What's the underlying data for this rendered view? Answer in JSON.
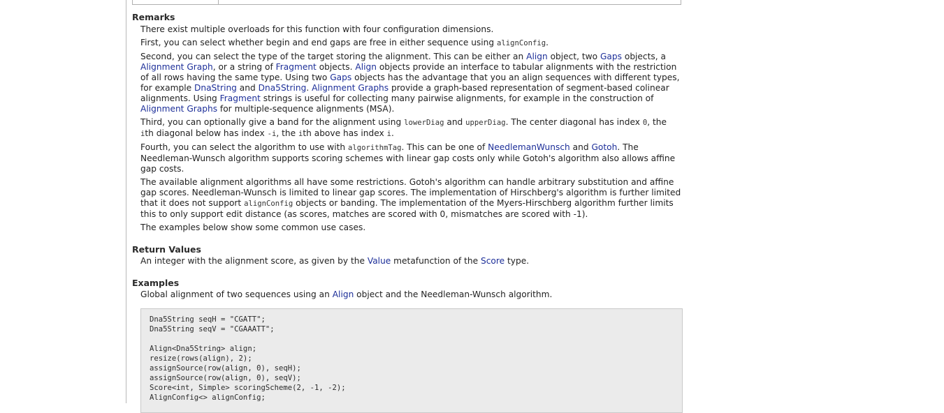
{
  "remarks": {
    "heading": "Remarks",
    "p1": "There exist multiple overloads for this function with four configuration dimensions.",
    "p2": {
      "t1": "First, you can select whether begin and end gaps are free in either sequence using ",
      "c1": "alignConfig",
      "t2": "."
    },
    "p3": {
      "t1": "Second, you can select the type of the target storing the alignment. This can be either an ",
      "l1": "Align",
      "t2": " object, two ",
      "l2": "Gaps",
      "t3": " objects, a ",
      "l3": "Alignment Graph",
      "t4": ", or a string of ",
      "l4": "Fragment",
      "t5": " objects. ",
      "l5": "Align",
      "t6": " objects provide an interface to tabular alignments with the restriction of all rows having the same type. Using two ",
      "l6": "Gaps",
      "t7": " objects has the advantage that you an align sequences with different types, for example ",
      "l7": "DnaString",
      "t8": " and ",
      "l8": "Dna5String",
      "t9": ". ",
      "l9": "Alignment Graphs",
      "t10": " provide a graph-based representation of segment-based colinear alignments. Using ",
      "l10": "Fragment",
      "t11": " strings is useful for collecting many pairwise alignments, for example in the construction of ",
      "l11": "Alignment Graphs",
      "t12": " for multiple-sequence alignments (MSA)."
    },
    "p4": {
      "t1": "Third, you can optionally give a band for the alignment using ",
      "c1": "lowerDiag",
      "t2": " and ",
      "c2": "upperDiag",
      "t3": ". The center diagonal has index ",
      "c3": "0",
      "t4": ", the ",
      "c4": "i",
      "t5": "th diagonal below has index ",
      "c5": "-i",
      "t6": ", the ",
      "c6": "i",
      "t7": "th above has index ",
      "c7": "i",
      "t8": "."
    },
    "p5": {
      "t1": "Fourth, you can select the algorithm to use with ",
      "c1": "algorithmTag",
      "t2": ". This can be one of ",
      "l1": "NeedlemanWunsch",
      "t3": " and ",
      "l2": "Gotoh",
      "t4": ". The Needleman-Wunsch algorithm supports scoring schemes with linear gap costs only while Gotoh's algorithm also allows affine gap costs."
    },
    "p6": {
      "t1": "The available alignment algorithms all have some restrictions. Gotoh's algorithm can handle arbitrary substitution and affine gap scores. Needleman-Wunsch is limited to linear gap scores. The implementation of Hirschberg's algorithm is further limited that it does not support ",
      "c1": "alignConfig",
      "t2": " objects or banding. The implementation of the Myers-Hirschberg algorithm further limits this to only support edit distance (as scores, matches are scored with 0, mismatches are scored with -1)."
    },
    "p7": "The examples below show some common use cases."
  },
  "return_values": {
    "heading": "Return Values",
    "t1": "An integer with the alignment score, as given by the ",
    "l1": "Value",
    "t2": " metafunction of the ",
    "l2": "Score",
    "t3": " type."
  },
  "examples": {
    "heading": "Examples",
    "t1": "Global alignment of two sequences using an ",
    "l1": "Align",
    "t2": " object and the Needleman-Wunsch algorithm.",
    "code_lines": [
      "Dna5String seqH = \"CGATT\";",
      "Dna5String seqV = \"CGAAATT\";",
      "",
      "Align<Dna5String> align;",
      "resize(rows(align), 2);",
      "assignSource(row(align, 0), seqH);",
      "assignSource(row(align, 0), seqV);",
      "Score<int, Simple> scoringScheme(2, -1, -2);",
      "AlignConfig<> alignConfig;"
    ]
  },
  "colors": {
    "link": "#1d2f99",
    "code_bg": "#ebebeb"
  }
}
